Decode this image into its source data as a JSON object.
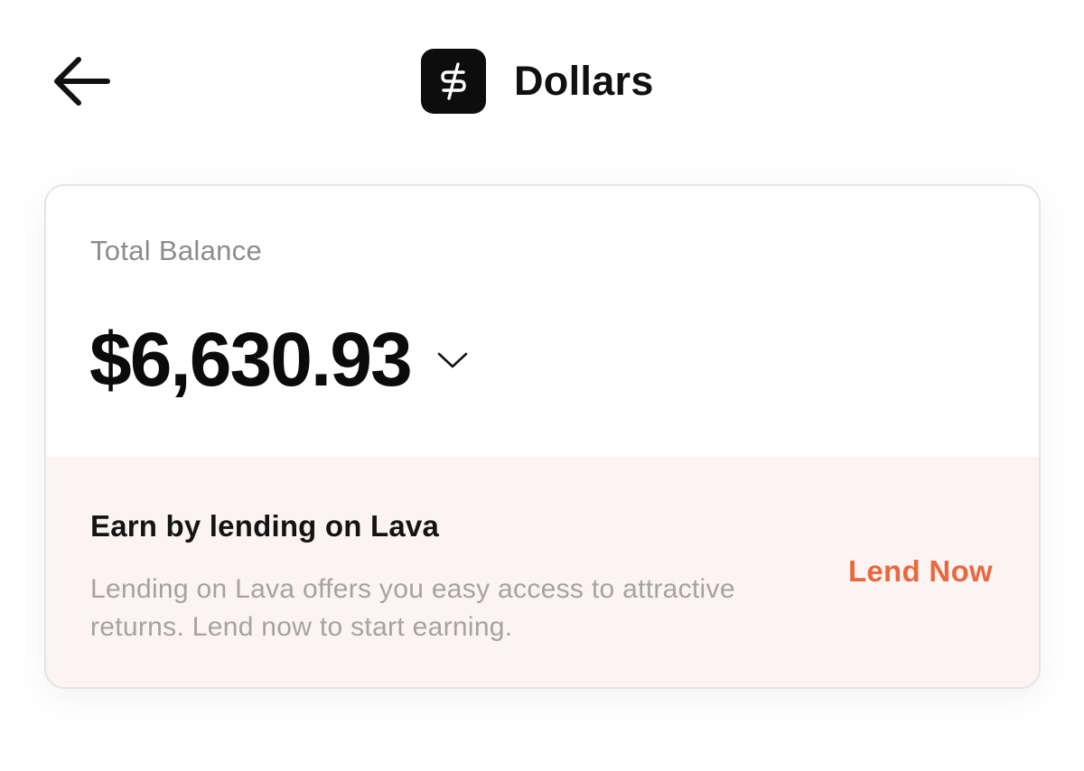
{
  "header": {
    "title": "Dollars",
    "back_icon": "arrow-left-icon",
    "app_icon": "dollar-icon"
  },
  "balance": {
    "label": "Total Balance",
    "amount": "$6,630.93",
    "expand_icon": "chevron-down-icon"
  },
  "promo": {
    "title": "Earn by lending on Lava",
    "description": "Lending on Lava offers you easy access to attractive returns. Lend now to start earning.",
    "cta_label": "Lend Now"
  },
  "colors": {
    "accent": "#e8693f",
    "promo_background": "#fcf4f2",
    "icon_background": "#0d0d0d"
  }
}
